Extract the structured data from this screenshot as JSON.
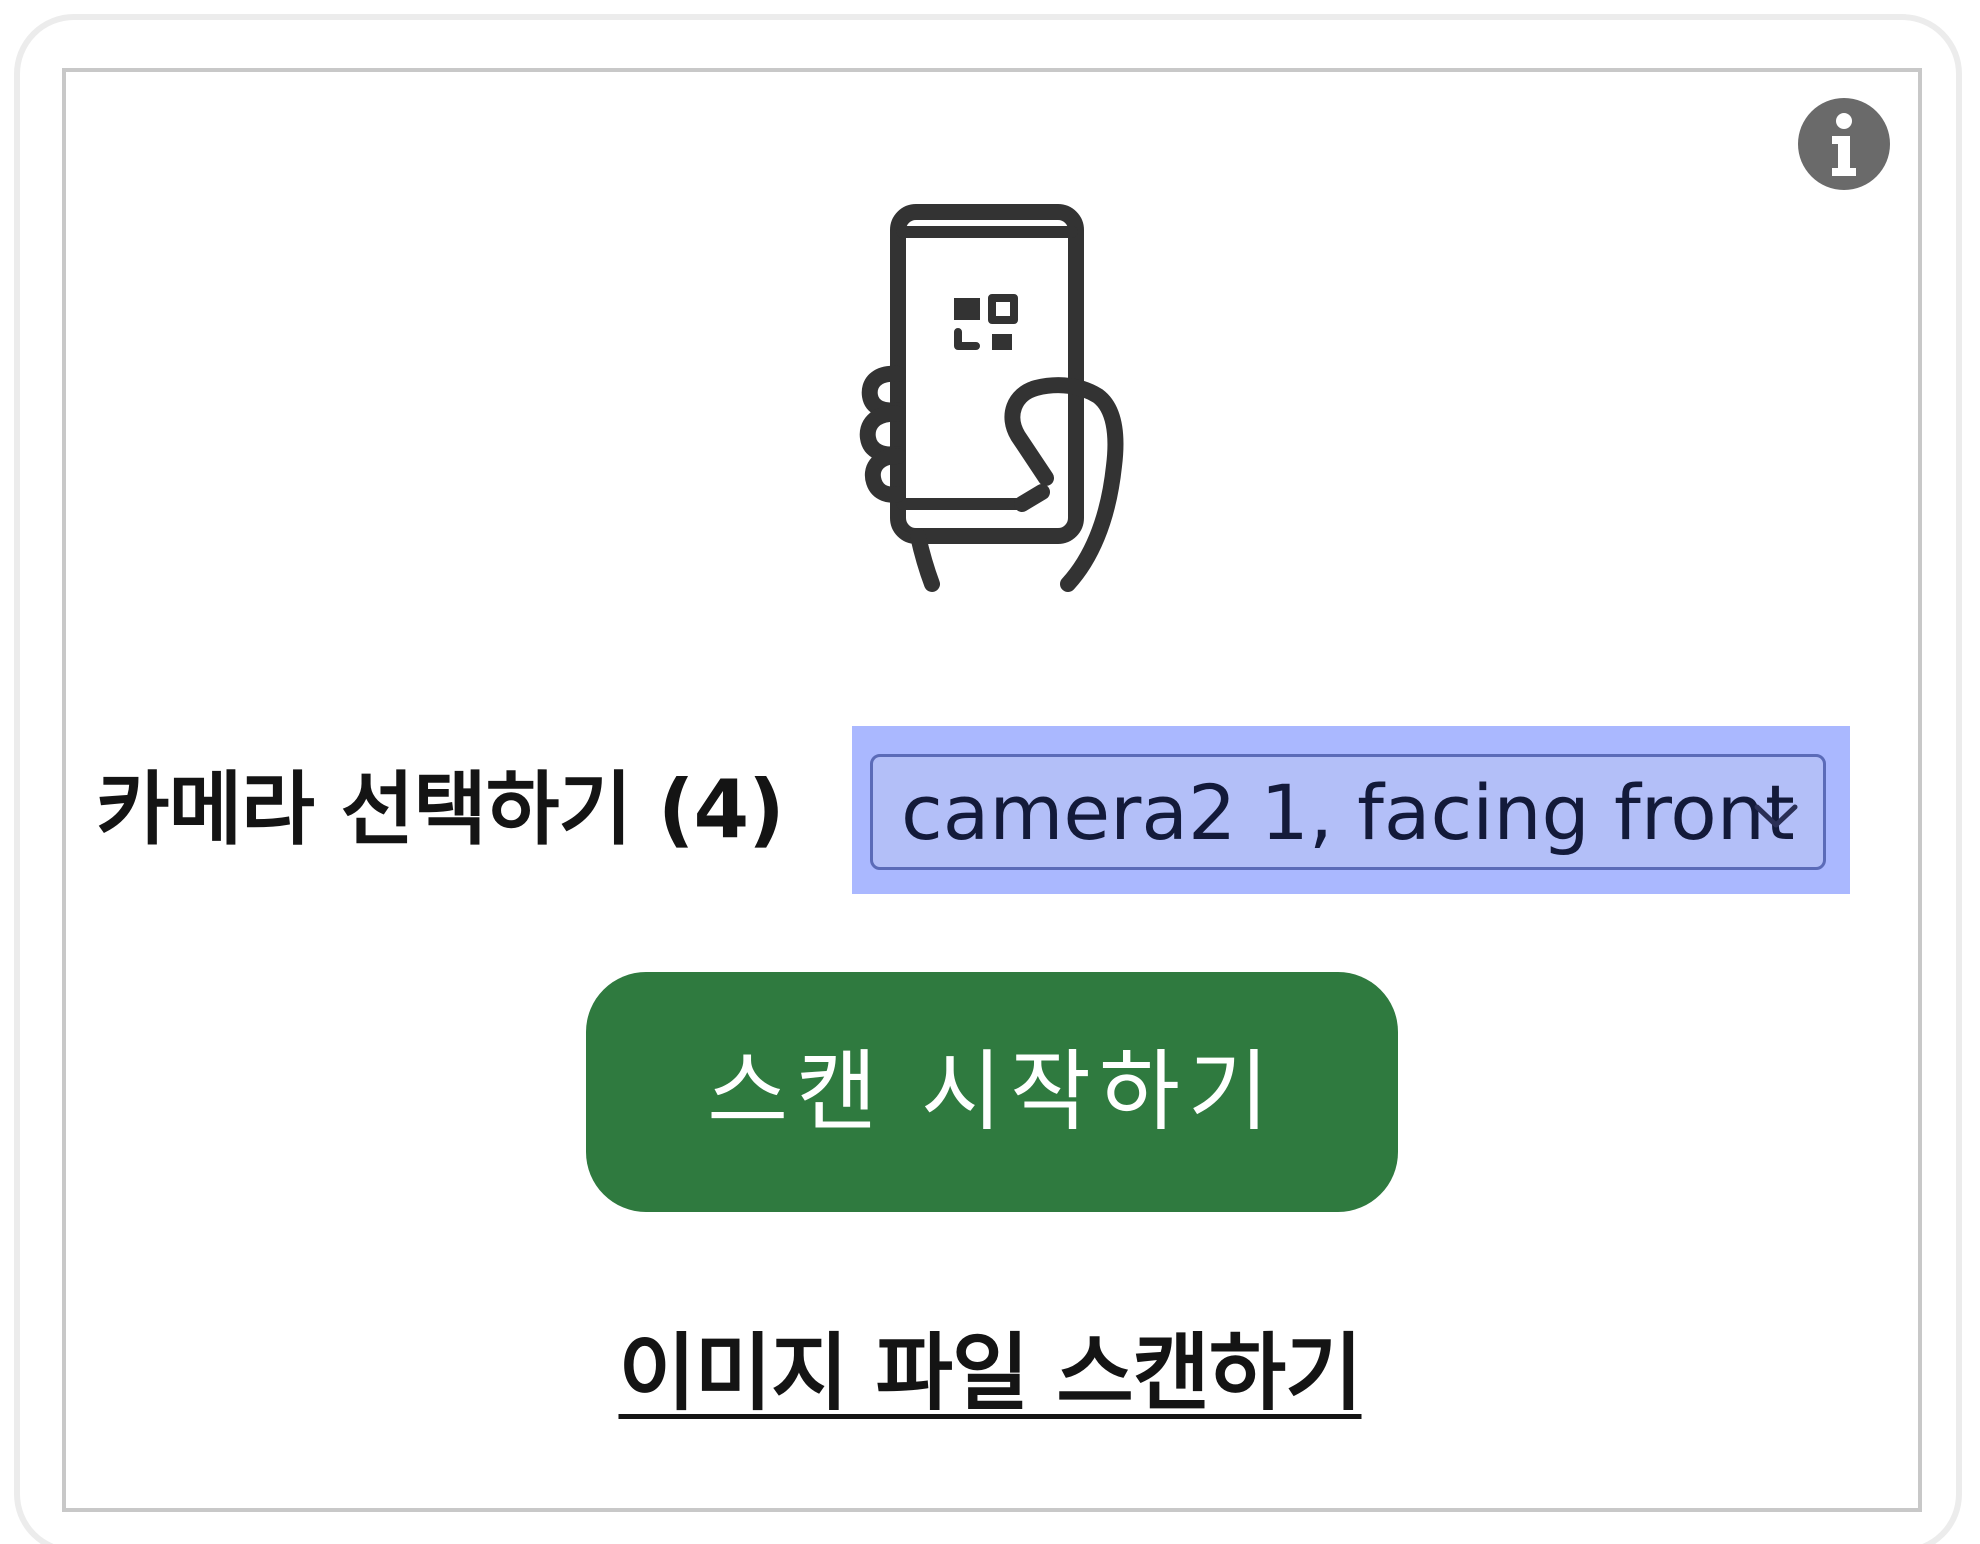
{
  "scanner": {
    "info_icon": "info-icon",
    "hero_icon": "hand-holding-phone-qr-icon",
    "camera_select": {
      "label": "카메라 선택하기 (4)",
      "value": "camera2 1, facing front",
      "icon": "chevron-down-icon"
    },
    "start_button_label": "스캔 시작하기",
    "scan_image_link_label": "이미지 파일 스캔하기"
  },
  "colors": {
    "accent_green": "#2f7a3f",
    "selection_highlight": "#aab8ff",
    "info_icon_fill": "#6a6a6a",
    "icon_stroke": "#333333"
  }
}
